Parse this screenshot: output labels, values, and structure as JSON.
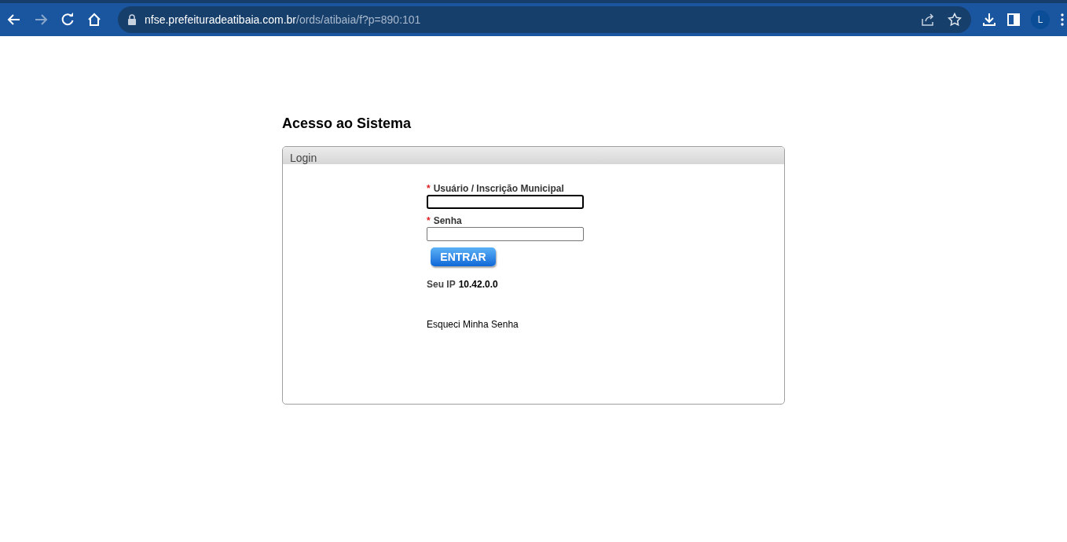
{
  "browser": {
    "url_host": "nfse.prefeituradeatibaia.com.br",
    "url_path": "/ords/atibaia/f?p=890:101",
    "profile_initial": "L",
    "forward_disabled": true
  },
  "page": {
    "title": "Acesso ao Sistema"
  },
  "panel": {
    "title": "Login",
    "fields": [
      {
        "required_mark": "*",
        "label": "Usuário / Inscrição Municipal",
        "focused": true
      },
      {
        "required_mark": "*",
        "label": "Senha",
        "focused": false
      }
    ],
    "button": "ENTRAR",
    "ip_label": "Seu IP",
    "ip_value": "10.42.0.0",
    "forgot_link": "Esqueci Minha Senha"
  }
}
